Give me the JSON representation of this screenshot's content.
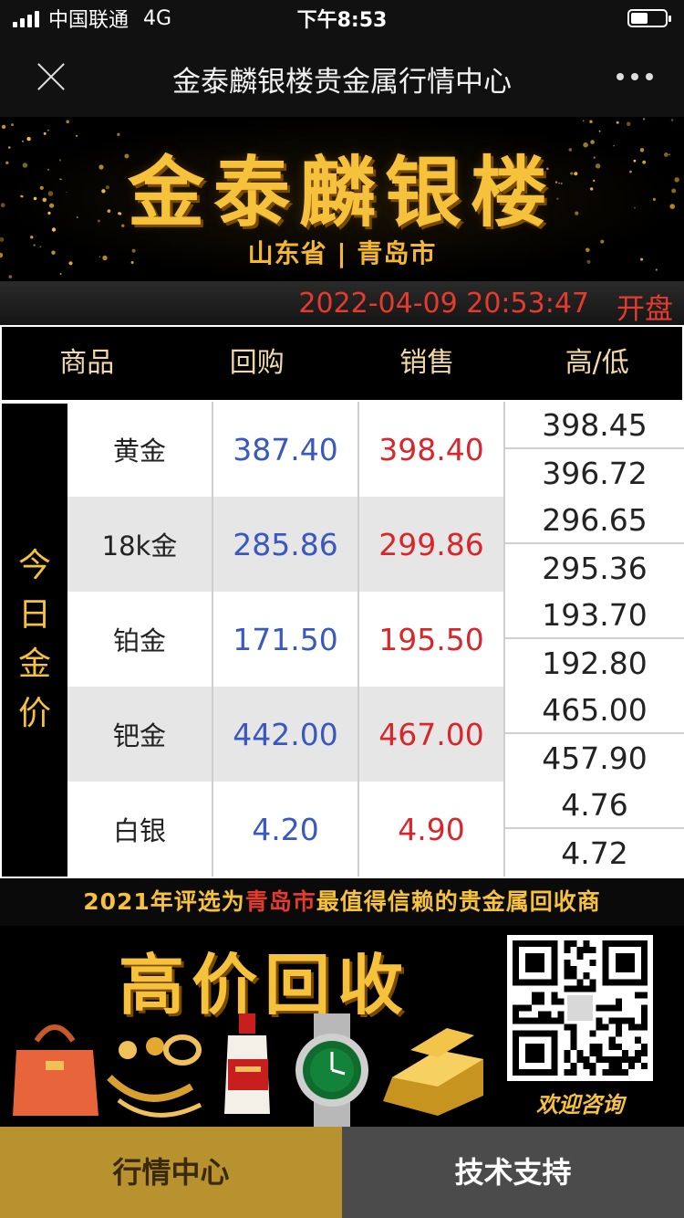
{
  "status_bar": {
    "carrier": "中国联通",
    "network": "4G",
    "time": "下午8:53",
    "battery_level": 0.45
  },
  "nav": {
    "title": "金泰麟银楼贵金属行情中心",
    "close_icon": "close-icon",
    "more_icon": "more-icon"
  },
  "banner": {
    "brand": "金泰麟银楼",
    "location": "山东省 | 青岛市"
  },
  "quote": {
    "datetime": "2022-04-09 20:53:47",
    "market_status": "开盘"
  },
  "table": {
    "headers": [
      "商品",
      "回购",
      "销售",
      "高/低"
    ],
    "side_label": [
      "今",
      "日",
      "金",
      "价"
    ],
    "rows": [
      {
        "name": "黄金",
        "buyback": "387.40",
        "sell": "398.40",
        "high": "398.45",
        "low": "396.72"
      },
      {
        "name": "18k金",
        "buyback": "285.86",
        "sell": "299.86",
        "high": "296.65",
        "low": "295.36"
      },
      {
        "name": "铂金",
        "buyback": "171.50",
        "sell": "195.50",
        "high": "193.70",
        "low": "192.80"
      },
      {
        "name": "钯金",
        "buyback": "442.00",
        "sell": "467.00",
        "high": "465.00",
        "low": "457.90"
      },
      {
        "name": "白银",
        "buyback": "4.20",
        "sell": "4.90",
        "high": "4.76",
        "low": "4.72"
      }
    ]
  },
  "award": {
    "prefix": "2021年评选为",
    "highlight": "青岛市",
    "suffix": "最值得信赖的贵金属回收商"
  },
  "ad": {
    "title": "高价回收",
    "qr_caption": "欢迎咨询"
  },
  "tabs": [
    {
      "label": "行情中心"
    },
    {
      "label": "技术支持"
    }
  ],
  "colors": {
    "gold": "#f6c23b",
    "buy_blue": "#3958c0",
    "sell_red": "#d8272b",
    "tab_active": "#b8922e"
  }
}
